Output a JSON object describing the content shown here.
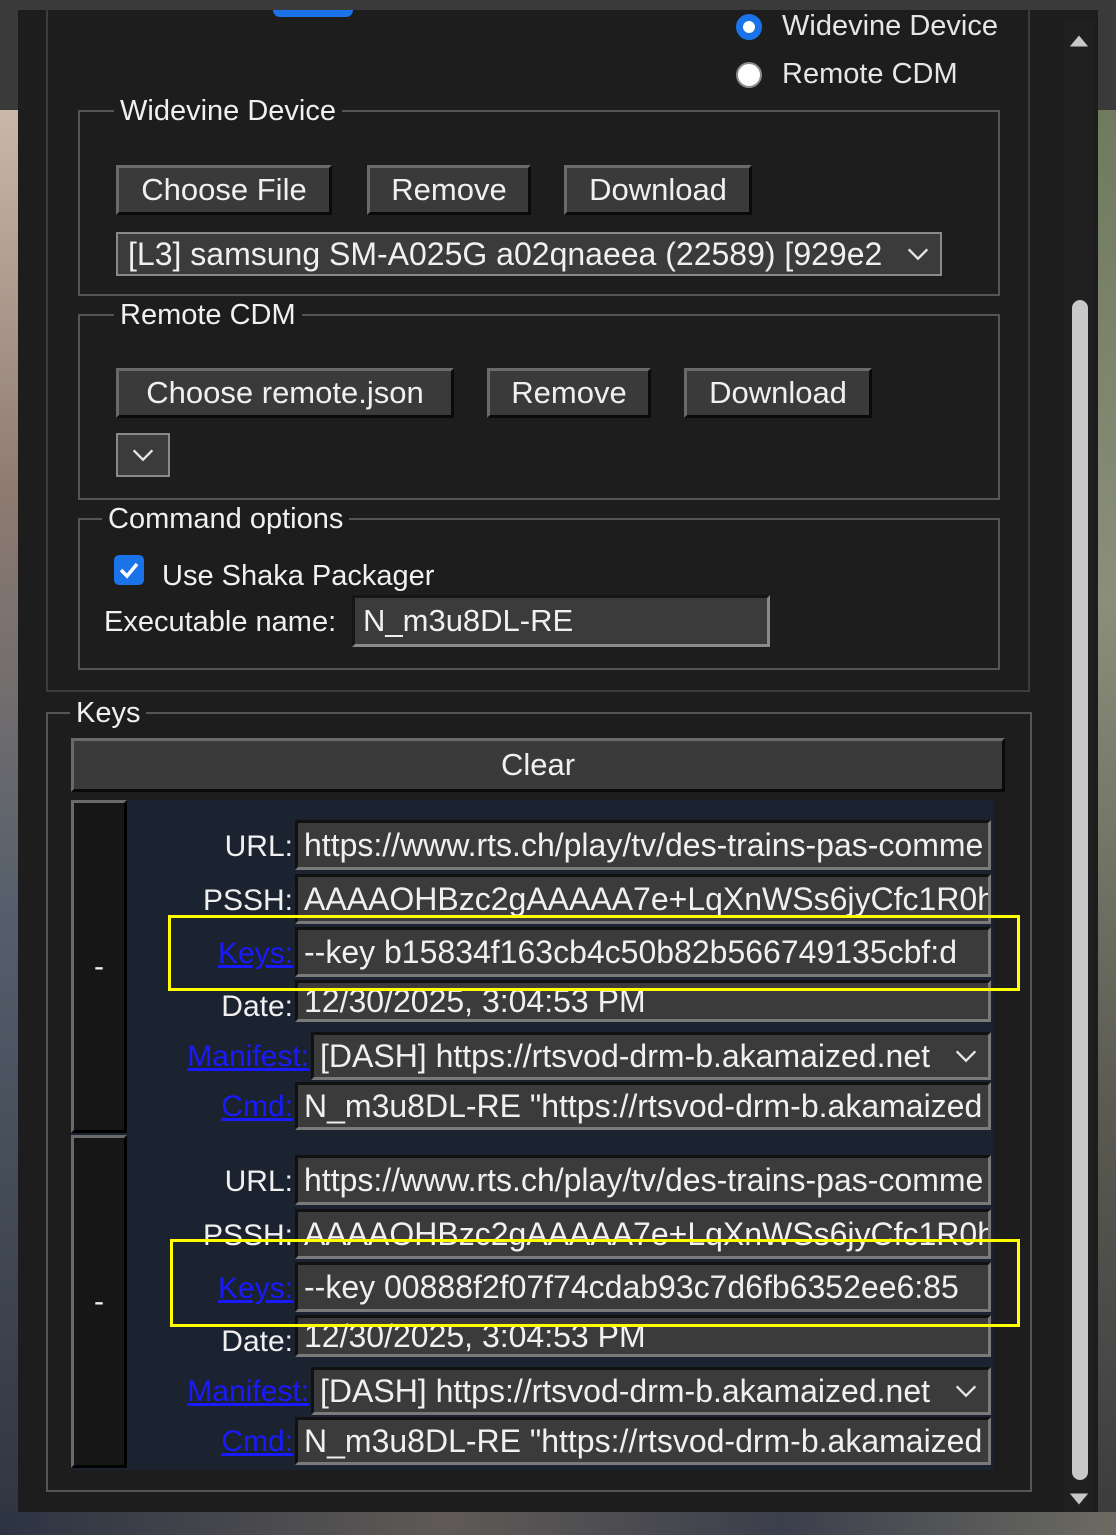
{
  "device_type": {
    "options": [
      {
        "label": "Widevine Device",
        "checked": true
      },
      {
        "label": "Remote CDM",
        "checked": false
      }
    ]
  },
  "widevine_device": {
    "legend": "Widevine Device",
    "choose_file": "Choose File",
    "remove": "Remove",
    "download": "Download",
    "selected_device": "[L3] samsung SM-A025G a02qnaeea (22589) [929e2"
  },
  "remote_cdm": {
    "legend": "Remote CDM",
    "choose_file": "Choose remote.json",
    "remove": "Remove",
    "download": "Download",
    "selected": ""
  },
  "command_options": {
    "legend": "Command options",
    "use_shaka_label": "Use Shaka Packager",
    "use_shaka_checked": true,
    "exe_label": "Executable name:",
    "exe_value": "N_m3u8DL-RE"
  },
  "keys": {
    "legend": "Keys",
    "clear": "Clear",
    "remove_entry": "-",
    "labels": {
      "url": "URL:",
      "pssh": "PSSH:",
      "keys": "Keys:",
      "date": "Date:",
      "manifest": "Manifest:",
      "cmd": "Cmd:"
    },
    "entries": [
      {
        "url": "https://www.rts.ch/play/tv/des-trains-pas-comme",
        "pssh": "AAAAOHBzc2gAAAAA7e+LqXnWSs6jyCfc1R0h",
        "keys": "--key b15834f163cb4c50b82b566749135cbf:d",
        "date": "12/30/2025, 3:04:53 PM",
        "manifest": "[DASH] https://rtsvod-drm-b.akamaized.net",
        "cmd": "N_m3u8DL-RE \"https://rtsvod-drm-b.akamaized"
      },
      {
        "url": "https://www.rts.ch/play/tv/des-trains-pas-comme",
        "pssh": "AAAAOHBzc2gAAAAA7e+LqXnWSs6jyCfc1R0h",
        "keys": "--key 00888f2f07f74cdab93c7d6fb6352ee6:85",
        "date": "12/30/2025, 3:04:53 PM",
        "manifest": "[DASH] https://rtsvod-drm-b.akamaized.net",
        "cmd": "N_m3u8DL-RE \"https://rtsvod-drm-b.akamaized"
      }
    ]
  },
  "colors": {
    "accent": "#1a73e8",
    "highlight": "#ffff00",
    "link": "#1a1aff"
  }
}
